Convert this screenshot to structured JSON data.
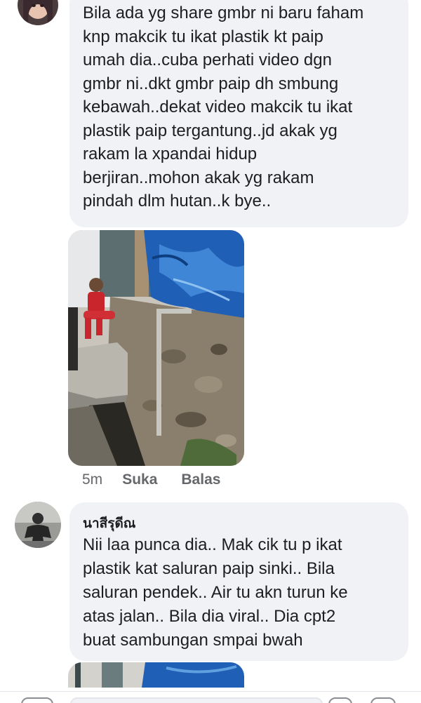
{
  "comments": [
    {
      "lines": [
        "Bila ada yg share gmbr ni baru faham",
        "knp makcik tu ikat plastik kt paip",
        "umah dia..cuba perhati video dgn",
        "gmbr ni..dkt gmbr paip dh smbung",
        "kebawah..dekat video makcik tu ikat",
        "plastik paip tergantung..jd akak yg",
        "rakam la xpandai hidup",
        "berjiran..mohon akak yg rakam",
        "pindah dlm hutan..k bye.."
      ]
    },
    {
      "author": "นาสีรุดีณ",
      "lines": [
        "Nii laa punca dia.. Mak cik tu p ikat",
        "plastik kat saluran paip sinki.. Bila",
        "saluran pendek.. Air tu akn turun ke",
        "atas jalan.. Bila dia viral.. Dia cpt2",
        "buat sambungan smpai bwah"
      ]
    }
  ],
  "actions": {
    "time": "5m",
    "like": "Suka",
    "reply": "Balas"
  },
  "colors": {
    "bubble": "#f0f2f5",
    "text": "#1c1e21",
    "meta": "#65676b"
  }
}
